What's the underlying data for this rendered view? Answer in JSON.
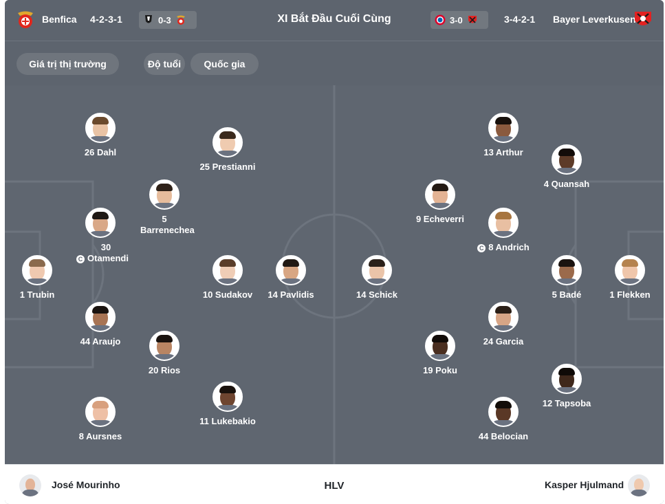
{
  "header": {
    "title": "XI Bắt Đầu Cuối Cùng",
    "home": {
      "name": "Benfica",
      "formation": "4-2-3-1",
      "last_result": "0-3"
    },
    "away": {
      "name": "Bayer Leverkusen",
      "formation": "3-4-2-1",
      "last_result": "3-0"
    }
  },
  "filters": [
    "Giá trị thị trường",
    "Độ tuổi",
    "Quốc gia"
  ],
  "home_players": [
    {
      "label": "26 Dahl",
      "skin": "#e9c3a5",
      "hair": "#6b4a2d"
    },
    {
      "label": "25 Prestianni",
      "skin": "#efcbb0",
      "hair": "#3b2a1d"
    },
    {
      "label": "5 Barrenechea",
      "skin": "#e6bc9c",
      "hair": "#2e2118"
    },
    {
      "label": "30 Otamendi",
      "skin": "#d9a887",
      "hair": "#1f1915",
      "captain": "C"
    },
    {
      "label": "1 Trubin",
      "skin": "#efc9b0",
      "hair": "#8a6a4d"
    },
    {
      "label": "10 Sudakov",
      "skin": "#efcdb6",
      "hair": "#5a3e2a"
    },
    {
      "label": "14 Pavlidis",
      "skin": "#d8a683",
      "hair": "#221a14"
    },
    {
      "label": "44 Araujo",
      "skin": "#a87454",
      "hair": "#1a130f"
    },
    {
      "label": "20 Rios",
      "skin": "#b98563",
      "hair": "#1a130f"
    },
    {
      "label": "8 Aursnes",
      "skin": "#eec0a6",
      "hair": "#d8a07e"
    },
    {
      "label": "11 Lukebakio",
      "skin": "#6e4530",
      "hair": "#1a120d"
    }
  ],
  "away_players": [
    {
      "label": "13 Arthur",
      "skin": "#8a5a3e",
      "hair": "#18110c"
    },
    {
      "label": "4 Quansah",
      "skin": "#5d3b28",
      "hair": "#120c09"
    },
    {
      "label": "9 Echeverri",
      "skin": "#e3b394",
      "hair": "#241a13"
    },
    {
      "label": "8 Andrich",
      "skin": "#e8bfa2",
      "hair": "#a7753f",
      "captain": "C"
    },
    {
      "label": "14 Schick",
      "skin": "#eac4a9",
      "hair": "#2b211a"
    },
    {
      "label": "5 Badé",
      "skin": "#9b6a4b",
      "hair": "#1a130f"
    },
    {
      "label": "1 Flekken",
      "skin": "#efc6ab",
      "hair": "#b5834f"
    },
    {
      "label": "24 Garcia",
      "skin": "#d7a586",
      "hair": "#2b1f17"
    },
    {
      "label": "19 Poku",
      "skin": "#4a2e20",
      "hair": "#110b08"
    },
    {
      "label": "12 Tapsoba",
      "skin": "#3f281b",
      "hair": "#0f0a07"
    },
    {
      "label": "44 Belocian",
      "skin": "#5a3826",
      "hair": "#130d09"
    }
  ],
  "coaches": {
    "label": "HLV",
    "home": {
      "name": "José Mourinho",
      "skin": "#e3b498"
    },
    "away": {
      "name": "Kasper Hjulmand",
      "skin": "#efc9ae"
    }
  },
  "colors": {
    "pitch": "#5f6670",
    "pitch_lines": "#6d747e",
    "benfica_red": "#e1261c",
    "leverkusen_red": "#e32221",
    "bayern_red": "#dc052d"
  },
  "icons": [
    "benfica-crest-icon",
    "leverkusen-crest-icon",
    "bayern-crest-icon",
    "vitoria-crest-icon",
    "captain-icon"
  ]
}
